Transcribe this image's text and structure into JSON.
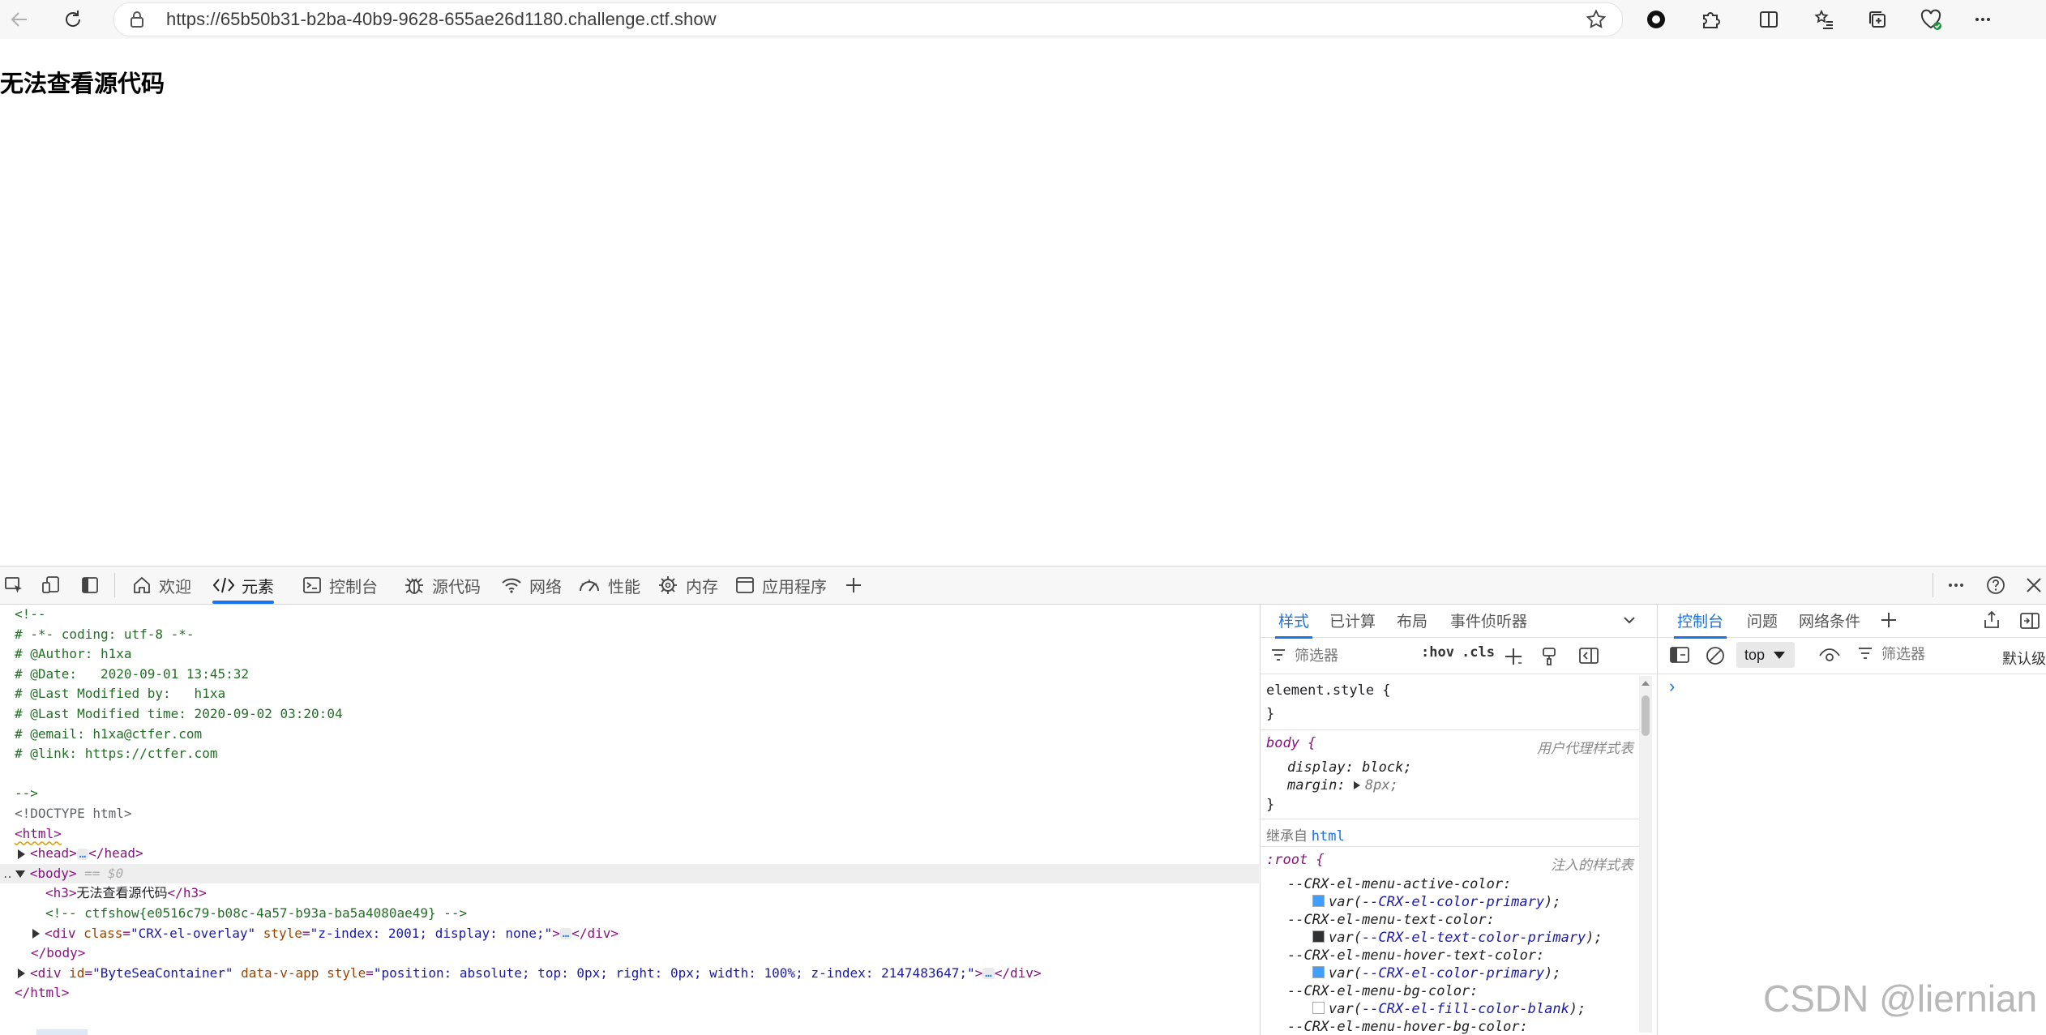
{
  "browser": {
    "url": "https://65b50b31-b2ba-40b9-9628-655ae26d1180.challenge.ctf.show"
  },
  "page": {
    "heading": "无法查看源代码"
  },
  "devtools": {
    "tabs": [
      {
        "label": "欢迎",
        "icon": "home-icon"
      },
      {
        "label": "元素",
        "icon": "code-icon",
        "active": true
      },
      {
        "label": "控制台",
        "icon": "console-icon"
      },
      {
        "label": "源代码",
        "icon": "bug-icon"
      },
      {
        "label": "网络",
        "icon": "wifi-icon"
      },
      {
        "label": "性能",
        "icon": "gauge-icon"
      },
      {
        "label": "内存",
        "icon": "chip-icon"
      },
      {
        "label": "应用程序",
        "icon": "window-icon"
      }
    ],
    "dom_lines": {
      "comment_open": "<!--",
      "coding": "# -*- coding: utf-8 -*-",
      "author": "# @Author: h1xa",
      "date": "# @Date:   2020-09-01 13:45:32",
      "last_modified_by": "# @Last Modified by:   h1xa",
      "last_modified_time": "# @Last Modified time: 2020-09-02 03:20:04",
      "email": "# @email: h1xa@ctfer.com",
      "link": "# @link: https://ctfer.com",
      "comment_close": "-->",
      "doctype": "<!DOCTYPE html>",
      "html_open": "<html>",
      "head_open": "<head>",
      "head_close": "</head>",
      "body_open": "<body>",
      "body_sel": "== $0",
      "h3_open": "<h3>",
      "h3_text": "无法查看源代码",
      "h3_close": "</h3>",
      "flag_comment": "<!-- ctfshow{e0516c79-b08c-4a57-b93a-ba5a4080ae49} -->",
      "div1_tag": "<div",
      "div1_attr1": "class",
      "div1_val1": "\"CRX-el-overlay\"",
      "div1_attr2": "style",
      "div1_val2": "\"z-index: 2001; display: none;\"",
      "div1_close": "</div>",
      "div2_tag": "<div",
      "div2_attr1": "id",
      "div2_val1": "\"ByteSeaContainer\"",
      "div2_attr2": "data-v-app",
      "div2_attr3": "style",
      "div2_val3": "\"position: absolute; top: 0px; right: 0px; width: 100%; z-index: 2147483647;\"",
      "div2_close": "</div>",
      "body_close": "</body>",
      "html_close": "</html>",
      "ellipsis": "…"
    },
    "styles": {
      "tabs": [
        "样式",
        "已计算",
        "布局",
        "事件侦听器"
      ],
      "filter_placeholder": "筛选器",
      "hov": ":hov",
      "cls": ".cls",
      "element_style": "element.style {",
      "close_brace": "}",
      "body_selector": "body {",
      "body_origin": "用户代理样式表",
      "display_prop": "display:",
      "display_val": "block;",
      "margin_prop": "margin:",
      "margin_val": "8px;",
      "inherited_label": "继承自",
      "inherited_from": "html",
      "root_selector": ":root {",
      "root_origin": "注入的样式表",
      "vars": [
        {
          "name": "--CRX-el-menu-active-color:",
          "ref": "--CRX-el-color-primary",
          "swatch": "#409eff"
        },
        {
          "name": "--CRX-el-menu-text-color:",
          "ref": "--CRX-el-text-color-primary",
          "swatch": "#303133"
        },
        {
          "name": "--CRX-el-menu-hover-text-color:",
          "ref": "--CRX-el-color-primary",
          "swatch": "#409eff"
        },
        {
          "name": "--CRX-el-menu-bg-color:",
          "ref": "--CRX-el-fill-color-blank",
          "swatch": "#ffffff"
        }
      ],
      "last_var": "--CRX-el-menu-hover-bg-color:",
      "var_fn": "var(",
      "var_close": ");"
    },
    "console": {
      "tabs": [
        "控制台",
        "问题",
        "网络条件"
      ],
      "context": "top",
      "filter_placeholder": "筛选器",
      "levels": "默认级",
      "prompt": "›"
    }
  },
  "watermark": "CSDN @liernian",
  "colors": {
    "accent": "#1a73e8",
    "comment": "#236e25",
    "tag": "#881280",
    "attr": "#994500",
    "value": "#1a1aa6"
  }
}
